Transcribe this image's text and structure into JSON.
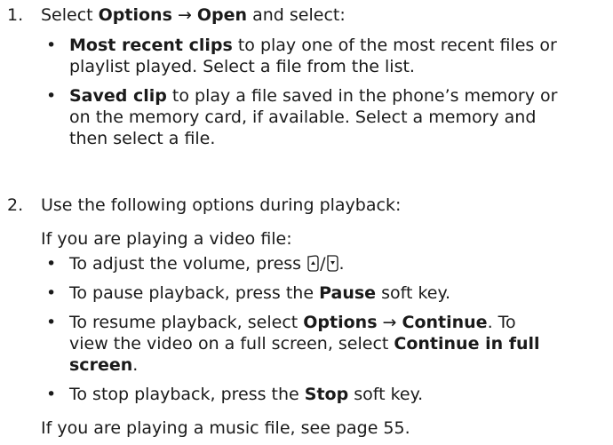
{
  "steps": [
    {
      "number": "1.",
      "intro": {
        "pre": "Select ",
        "b1": "Options",
        "arrow": " → ",
        "b2": "Open",
        "post": " and select:"
      },
      "bullets": [
        {
          "bold": "Most recent clips",
          "line1": " to play one of the most recent files or",
          "line2": "playlist played. Select a file from the list."
        },
        {
          "bold": "Saved clip",
          "line1": " to play a file saved in the phone’s memory or",
          "line2": "on the memory card, if available. Select a memory and",
          "line3": "then select a file."
        }
      ]
    },
    {
      "number": "2.",
      "intro": "Use the following options during playback:",
      "video_intro": "If you are playing a video file:",
      "bullets": [
        {
          "pre": "To adjust the volume, press ",
          "icon_up": "volume-up-key-icon",
          "sep": "/",
          "icon_down": "volume-down-key-icon",
          "post": "."
        },
        {
          "pre": "To pause playback, press the ",
          "bold": "Pause",
          "post": " soft key."
        },
        {
          "pre": "To resume playback, select ",
          "b1": "Options",
          "arrow": " → ",
          "b2": "Continue",
          "post": ". To",
          "line2_pre": "view the video on a full screen, select ",
          "line2_bold": "Continue in full",
          "line3_bold": "screen",
          "line3_post": "."
        },
        {
          "pre": "To stop playback, press the ",
          "bold": "Stop",
          "post": " soft key."
        }
      ],
      "music_note": "If you are playing a music file, see page 55."
    }
  ]
}
